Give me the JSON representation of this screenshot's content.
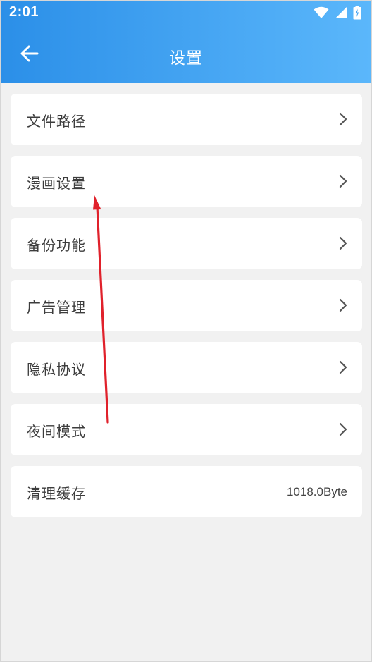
{
  "status_bar": {
    "time": "2:01",
    "icons": [
      "wifi-icon",
      "signal-icon",
      "battery-charging-icon"
    ]
  },
  "header": {
    "title": "设置",
    "back_icon": "arrow-left-icon"
  },
  "settings": {
    "items": [
      {
        "label": "文件路径",
        "icon": "chevron-right-icon"
      },
      {
        "label": "漫画设置",
        "icon": "chevron-right-icon"
      },
      {
        "label": "备份功能",
        "icon": "chevron-right-icon"
      },
      {
        "label": "广告管理",
        "icon": "chevron-right-icon"
      },
      {
        "label": "隐私协议",
        "icon": "chevron-right-icon"
      },
      {
        "label": "夜间模式",
        "icon": "chevron-right-icon"
      }
    ],
    "cache": {
      "label": "清理缓存",
      "value": "1018.0Byte"
    }
  },
  "annotation": {
    "type": "red-arrow",
    "points_to": "漫画设置"
  },
  "colors": {
    "header_gradient_start": "#2b8fe8",
    "header_gradient_end": "#5bb7fb",
    "background": "#f1f1f1",
    "card": "#ffffff",
    "text": "#3c3c3c",
    "chevron": "#555555",
    "annotation_arrow": "#e0212b"
  }
}
